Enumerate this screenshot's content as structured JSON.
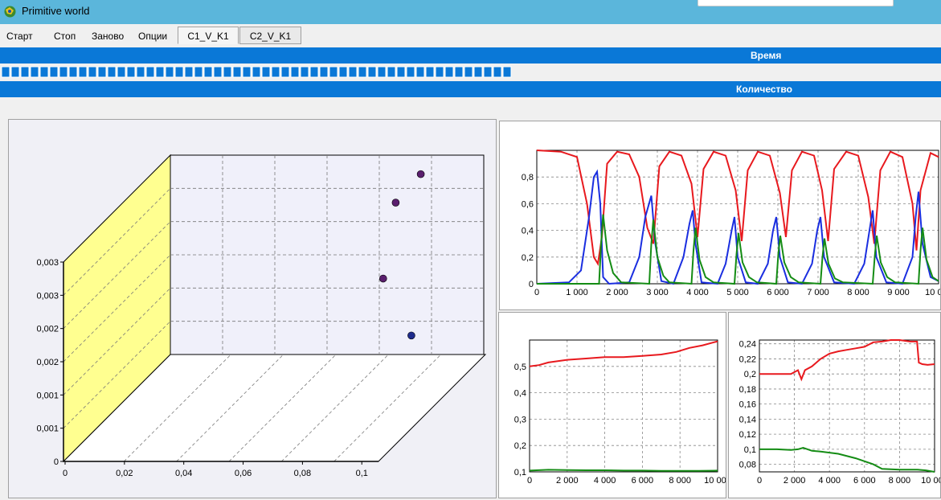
{
  "window": {
    "title": "Primitive world"
  },
  "menu": [
    "Старт",
    "Стоп",
    "Заново",
    "Опции"
  ],
  "tabs": [
    "C1_V_K1",
    "C2_V_K1"
  ],
  "bars": {
    "time": "Время",
    "count": "Количество"
  },
  "progress": {
    "segments_filled": 53
  },
  "chart_data": [
    {
      "type": "scatter",
      "title": "",
      "projection": "3d",
      "x_ticks": [
        "0",
        "0,02",
        "0,04",
        "0,06",
        "0,08",
        "0,1"
      ],
      "y_ticks": [
        "0",
        "0,001",
        "0,001",
        "0,002",
        "0,002",
        "0,003",
        "0,003"
      ],
      "xlim": [
        0,
        0.1
      ],
      "grid": true,
      "points": [
        {
          "x": 0.094,
          "y": 0.003,
          "color": "#5a1e6e"
        },
        {
          "x": 0.086,
          "y": 0.0027,
          "color": "#5a1e6e"
        },
        {
          "x": 0.082,
          "y": 0.0019,
          "color": "#5a1e6e"
        },
        {
          "x": 0.091,
          "y": 0.0013,
          "color": "#1e2b8c"
        }
      ]
    },
    {
      "type": "line",
      "title": "",
      "xlim": [
        0,
        10000
      ],
      "ylim": [
        0,
        1
      ],
      "x_ticks": [
        "0",
        "1 000",
        "2 000",
        "3 000",
        "4 000",
        "5 000",
        "6 000",
        "7 000",
        "8 000",
        "9 000",
        "10 000"
      ],
      "y_ticks": [
        "0",
        "0,2",
        "0,4",
        "0,6",
        "0,8"
      ],
      "grid": true,
      "series": [
        {
          "color": "#e8191e",
          "x": [
            0,
            600,
            1000,
            1250,
            1420,
            1520,
            1620,
            1750,
            2000,
            2300,
            2550,
            2750,
            2900,
            3050,
            3300,
            3600,
            3850,
            4000,
            4150,
            4400,
            4700,
            4950,
            5100,
            5250,
            5500,
            5800,
            6050,
            6200,
            6350,
            6600,
            6900,
            7100,
            7250,
            7400,
            7700,
            8000,
            8250,
            8400,
            8550,
            8800,
            9100,
            9350,
            9450,
            9550,
            9800,
            10000
          ],
          "y": [
            1,
            0.99,
            0.95,
            0.6,
            0.2,
            0.15,
            0.35,
            0.9,
            0.99,
            0.97,
            0.8,
            0.42,
            0.3,
            0.88,
            0.99,
            0.96,
            0.75,
            0.35,
            0.86,
            0.99,
            0.96,
            0.7,
            0.32,
            0.85,
            0.99,
            0.96,
            0.68,
            0.35,
            0.85,
            0.99,
            0.96,
            0.7,
            0.32,
            0.86,
            0.99,
            0.96,
            0.65,
            0.3,
            0.85,
            0.99,
            0.95,
            0.6,
            0.25,
            0.7,
            0.98,
            0.95
          ]
        },
        {
          "color": "#1a2ee0",
          "x": [
            0,
            800,
            1100,
            1300,
            1420,
            1500,
            1580,
            1650,
            1800,
            2300,
            2550,
            2700,
            2850,
            2950,
            3100,
            3400,
            3650,
            3800,
            3880,
            3950,
            4100,
            4500,
            4700,
            4850,
            4920,
            5000,
            5200,
            5500,
            5750,
            5880,
            5960,
            6050,
            6250,
            6600,
            6850,
            6980,
            7060,
            7150,
            7400,
            7900,
            8150,
            8280,
            8360,
            8450,
            8700,
            9100,
            9350,
            9430,
            9500,
            9600,
            9800,
            10000
          ],
          "y": [
            0,
            0.01,
            0.1,
            0.5,
            0.8,
            0.84,
            0.6,
            0.05,
            0,
            0.01,
            0.2,
            0.5,
            0.66,
            0.3,
            0.02,
            0,
            0.2,
            0.45,
            0.55,
            0.3,
            0.01,
            0,
            0.15,
            0.4,
            0.5,
            0.2,
            0.01,
            0,
            0.15,
            0.4,
            0.5,
            0.2,
            0.01,
            0,
            0.15,
            0.4,
            0.5,
            0.2,
            0.01,
            0,
            0.15,
            0.4,
            0.55,
            0.2,
            0.01,
            0,
            0.2,
            0.5,
            0.69,
            0.3,
            0.05,
            0.02
          ]
        },
        {
          "color": "#148c14",
          "x": [
            0,
            1550,
            1600,
            1650,
            1750,
            1900,
            2100,
            2800,
            2850,
            2900,
            3000,
            3150,
            3300,
            3850,
            3900,
            3950,
            4050,
            4200,
            4400,
            4920,
            4970,
            5020,
            5120,
            5280,
            5480,
            5960,
            6010,
            6060,
            6160,
            6320,
            6520,
            7060,
            7110,
            7160,
            7260,
            7420,
            7620,
            8360,
            8410,
            8460,
            8560,
            8720,
            8920,
            9500,
            9550,
            9600,
            9700,
            9850,
            10000
          ],
          "y": [
            0,
            0,
            0.3,
            0.52,
            0.25,
            0.08,
            0.01,
            0,
            0.3,
            0.48,
            0.2,
            0.06,
            0.01,
            0,
            0.25,
            0.42,
            0.18,
            0.05,
            0.01,
            0,
            0.22,
            0.38,
            0.16,
            0.05,
            0.01,
            0,
            0.22,
            0.36,
            0.16,
            0.05,
            0.01,
            0,
            0.2,
            0.34,
            0.15,
            0.04,
            0.01,
            0,
            0.2,
            0.36,
            0.16,
            0.05,
            0.01,
            0,
            0.25,
            0.42,
            0.18,
            0.05,
            0.02
          ]
        }
      ]
    },
    {
      "type": "line",
      "title": "",
      "xlim": [
        0,
        10000
      ],
      "ylim": [
        0.1,
        0.6
      ],
      "x_ticks": [
        "0",
        "2 000",
        "4 000",
        "6 000",
        "8 000",
        "10 000"
      ],
      "y_ticks": [
        "0,1",
        "0,2",
        "0,3",
        "0,4",
        "0,5"
      ],
      "grid": true,
      "series": [
        {
          "color": "#e8191e",
          "x": [
            0,
            500,
            1000,
            2000,
            3000,
            4000,
            5000,
            6000,
            7000,
            7800,
            8500,
            9200,
            10000
          ],
          "y": [
            0.5,
            0.505,
            0.515,
            0.525,
            0.53,
            0.535,
            0.535,
            0.54,
            0.545,
            0.555,
            0.57,
            0.58,
            0.595
          ]
        },
        {
          "color": "#148c14",
          "x": [
            0,
            1000,
            2000,
            3000,
            4000,
            5000,
            6000,
            7000,
            8000,
            9000,
            10000
          ],
          "y": [
            0.105,
            0.108,
            0.107,
            0.106,
            0.106,
            0.105,
            0.105,
            0.104,
            0.104,
            0.104,
            0.105
          ]
        }
      ]
    },
    {
      "type": "line",
      "title": "",
      "xlim": [
        0,
        10000
      ],
      "ylim": [
        0.07,
        0.245
      ],
      "x_ticks": [
        "0",
        "2 000",
        "4 000",
        "6 000",
        "8 000",
        "10 000"
      ],
      "y_ticks": [
        "0,08",
        "0,1",
        "0,12",
        "0,14",
        "0,16",
        "0,18",
        "0,2",
        "0,22",
        "0,24"
      ],
      "grid": true,
      "series": [
        {
          "color": "#e8191e",
          "x": [
            0,
            1000,
            1800,
            2200,
            2400,
            2600,
            3000,
            3500,
            4000,
            4500,
            5000,
            5500,
            6000,
            6500,
            7000,
            7500,
            8000,
            8600,
            9000,
            9100,
            9300,
            9600,
            10000
          ],
          "y": [
            0.2,
            0.2,
            0.2,
            0.205,
            0.193,
            0.205,
            0.21,
            0.22,
            0.227,
            0.23,
            0.232,
            0.234,
            0.236,
            0.242,
            0.243,
            0.245,
            0.245,
            0.243,
            0.243,
            0.215,
            0.213,
            0.212,
            0.213
          ]
        },
        {
          "color": "#148c14",
          "x": [
            0,
            1000,
            1800,
            2200,
            2500,
            3000,
            3500,
            4500,
            5500,
            6500,
            7000,
            8000,
            9000,
            9500,
            10000
          ],
          "y": [
            0.1,
            0.1,
            0.099,
            0.1,
            0.102,
            0.098,
            0.097,
            0.094,
            0.088,
            0.08,
            0.074,
            0.073,
            0.073,
            0.072,
            0.07
          ]
        }
      ]
    }
  ]
}
